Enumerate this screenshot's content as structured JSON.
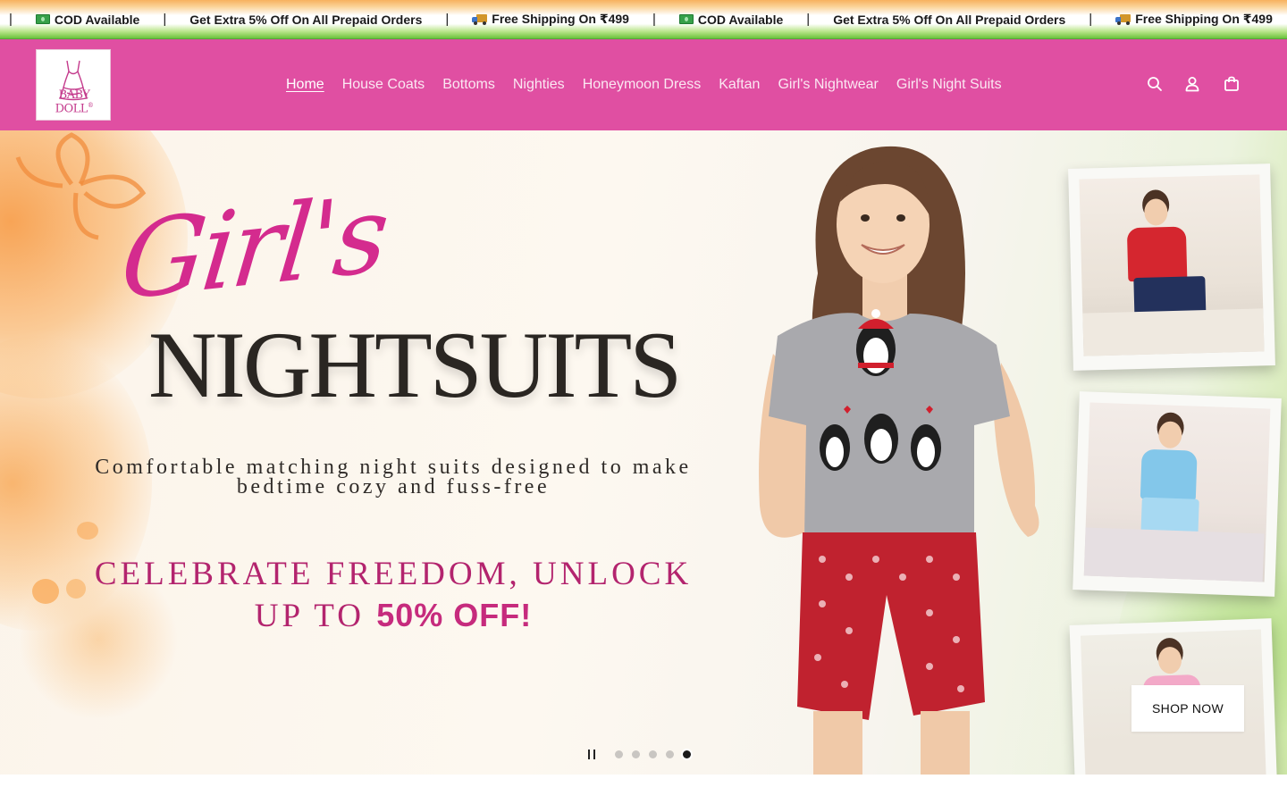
{
  "announcement": {
    "items": [
      {
        "icon": "cash-icon",
        "text": "COD Available"
      },
      {
        "icon": "",
        "text": "Get Extra 5% Off On All Prepaid Orders"
      },
      {
        "icon": "truck-icon",
        "text": "Free Shipping On ₹499"
      },
      {
        "icon": "cash-icon",
        "text": "COD Available"
      },
      {
        "icon": "",
        "text": "Get Extra 5% Off On All Prepaid Orders"
      },
      {
        "icon": "truck-icon",
        "text": "Free Shipping On ₹499"
      }
    ],
    "separator": "|"
  },
  "header": {
    "logo_text": "BABY DOLL",
    "logo_mark": "®",
    "nav": [
      {
        "label": "Home",
        "active": true
      },
      {
        "label": "House Coats",
        "active": false
      },
      {
        "label": "Bottoms",
        "active": false
      },
      {
        "label": "Nighties",
        "active": false
      },
      {
        "label": "Honeymoon Dress",
        "active": false
      },
      {
        "label": "Kaftan",
        "active": false
      },
      {
        "label": "Girl's Nightwear",
        "active": false
      },
      {
        "label": "Girl's Night Suits",
        "active": false
      }
    ],
    "icons": [
      "search-icon",
      "account-icon",
      "cart-icon"
    ],
    "bg_color": "#e04fa2"
  },
  "hero": {
    "title_script": "Girl's",
    "title_main": "NIGHTSUITS",
    "subtitle_line1": "Comfortable matching night suits designed to make",
    "subtitle_line2": "bedtime cozy and fuss-free",
    "promo_line1": "CELEBRATE FREEDOM, UNLOCK",
    "promo_line2_prefix": "UP TO",
    "promo_line2_highlight": "50% OFF!",
    "cta_label": "SHOP NOW",
    "slides_total": 5,
    "active_slide": 5
  }
}
